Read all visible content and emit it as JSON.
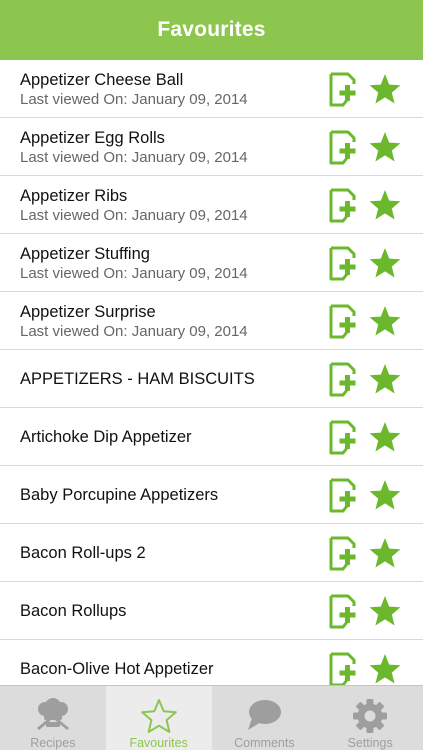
{
  "header": {
    "title": "Favourites"
  },
  "colors": {
    "accent": "#8cc64f",
    "tab_inactive": "#9e9e9e"
  },
  "list": {
    "rows": [
      {
        "title": "Appetizer Cheese Ball",
        "subtitle": "Last viewed On: January 09, 2014"
      },
      {
        "title": "Appetizer Egg Rolls",
        "subtitle": "Last viewed On: January 09, 2014"
      },
      {
        "title": "Appetizer Ribs",
        "subtitle": "Last viewed On: January 09, 2014"
      },
      {
        "title": "Appetizer Stuffing",
        "subtitle": "Last viewed On: January 09, 2014"
      },
      {
        "title": "Appetizer Surprise",
        "subtitle": "Last viewed On: January 09, 2014"
      },
      {
        "title": "APPETIZERS - HAM BISCUITS"
      },
      {
        "title": "Artichoke Dip Appetizer"
      },
      {
        "title": "Baby Porcupine Appetizers"
      },
      {
        "title": "Bacon Roll-ups 2"
      },
      {
        "title": "Bacon Rollups"
      },
      {
        "title": "Bacon-Olive Hot Appetizer"
      }
    ],
    "row_icons": [
      "add-note-icon",
      "star-icon"
    ]
  },
  "tabbar": {
    "tabs": [
      {
        "label": "Recipes",
        "icon": "chef-hat-icon",
        "active": false
      },
      {
        "label": "Favourites",
        "icon": "star-outline-icon",
        "active": true
      },
      {
        "label": "Comments",
        "icon": "speech-bubble-icon",
        "active": false
      },
      {
        "label": "Settings",
        "icon": "gear-icon",
        "active": false
      }
    ]
  }
}
